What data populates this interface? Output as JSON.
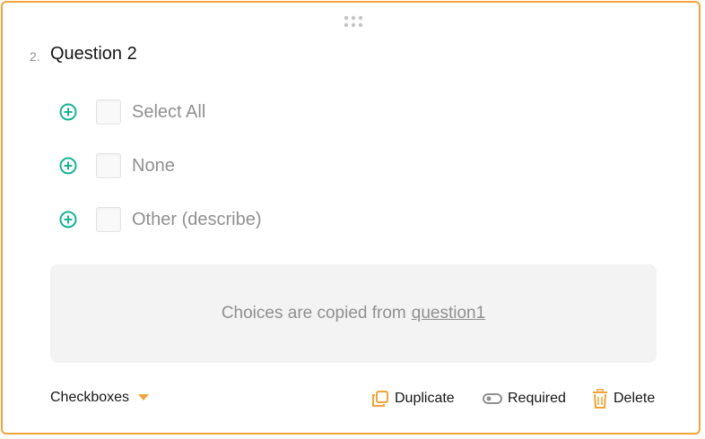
{
  "question": {
    "number": "2.",
    "title": "Question 2"
  },
  "choices": [
    {
      "label": "Select All"
    },
    {
      "label": "None"
    },
    {
      "label": "Other (describe)"
    }
  ],
  "copied_notice": {
    "text": "Choices are copied from",
    "source_link": "question1"
  },
  "footer": {
    "type_label": "Checkboxes",
    "duplicate_label": "Duplicate",
    "required_label": "Required",
    "delete_label": "Delete"
  },
  "colors": {
    "accent": "#f0a43a",
    "add_icon": "#19b394",
    "muted_text": "#909090",
    "panel_bg": "#f3f3f3"
  },
  "icons": {
    "drag": "drag-handle-icon",
    "add": "plus-circle-icon",
    "caret": "caret-down-icon",
    "duplicate": "duplicate-icon",
    "required": "toggle-icon",
    "delete": "trash-icon"
  }
}
